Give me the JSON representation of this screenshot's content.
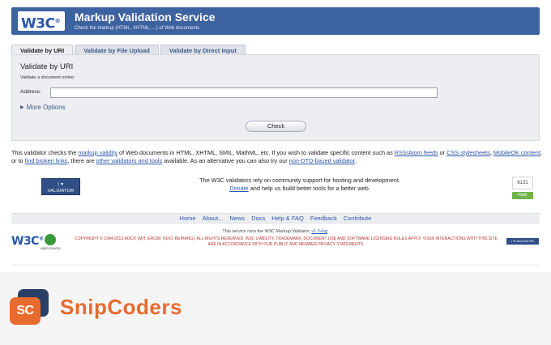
{
  "banner": {
    "logo_text": "W3C",
    "logo_sup": "®",
    "title": "Markup Validation Service",
    "subtitle": "Check the markup (HTML, XHTML, ...) of Web documents"
  },
  "tabs": [
    {
      "label": "Validate by URI",
      "active": true
    },
    {
      "label": "Validate by File Upload",
      "active": false
    },
    {
      "label": "Validate by Direct Input",
      "active": false
    }
  ],
  "form": {
    "heading": "Validate by URI",
    "hint": "Validate a document online:",
    "address_label": "Address:",
    "address_value": "",
    "more_options_label": "More Options",
    "check_label": "Check"
  },
  "intro": {
    "t1": "This validator checks the ",
    "l1": "markup validity",
    "t2": " of Web documents in HTML, XHTML, SMIL, MathML, etc. If you wish to validate specific content such as ",
    "l2": "RSS/Atom feeds",
    "t3": " or ",
    "l3": "CSS stylesheets",
    "t4": ", ",
    "l4": "MobileOK content",
    "t5": ", or to ",
    "l5": "find broken links",
    "t6": ", there are ",
    "l6": "other validators and tools",
    "t7": " available. As an alternative you can also try our ",
    "l7": "non-DTD-based validator",
    "t8": "."
  },
  "donation": {
    "badge_line1": "I ♥",
    "badge_line2": "VALIDATOR",
    "line1": "The W3C validators rely on community support for hosting and development.",
    "donate_link": "Donate",
    "line2_rest": " and help us build better tools for a better web.",
    "flattr_count": "6131",
    "flattr_label": "Flattr"
  },
  "nav": [
    "Home",
    "About...",
    "News",
    "Docs",
    "Help & FAQ",
    "Feedback",
    "Contribute"
  ],
  "footer": {
    "runs_text": "This service runs the W3C Markup Validator, ",
    "version_link": "v1.3+hg",
    "runs_end": ".",
    "copyright": "COPYRIGHT © 1994-2013 W3C® (MIT, ERCIM, KEIO, BEIHANG), ALL RIGHTS RESERVED. W3C LIABILITY, TRADEMARK, DOCUMENT USE AND SOFTWARE LICENSING RULES APPLY. YOUR INTERACTIONS WITH THIS SITE ARE IN ACCORDANCE WITH OUR PUBLIC AND MEMBER PRIVACY STATEMENTS.",
    "w3c_text": "W3C",
    "w3c_sup": "®",
    "opensource_label": "open source",
    "badge_text": "I ♥ VALIDATOR"
  },
  "brand": {
    "icon_text": "SC",
    "name": "SnipCoders"
  }
}
